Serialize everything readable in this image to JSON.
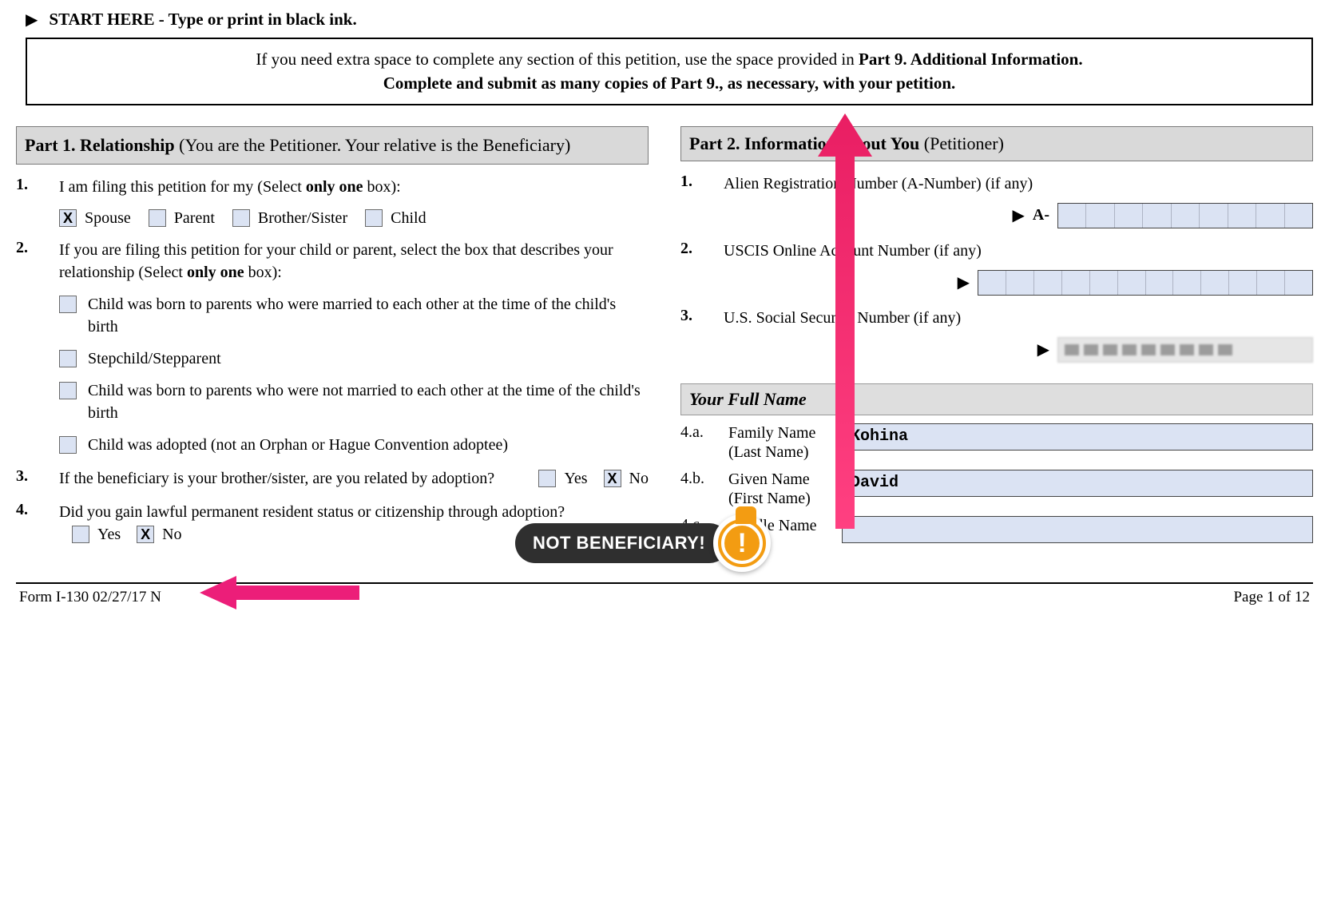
{
  "header": {
    "start_here": "START HERE - Type or print in black ink.",
    "notice_pre": "If you need extra space to complete any section of this petition, use the space provided in ",
    "notice_bold1": "Part 9. Additional Information.",
    "notice_line2a": "Complete and submit as many copies of Part 9., as necessary, with your petition."
  },
  "part1": {
    "title_bold": "Part 1.  Relationship",
    "title_rest": " (You are the Petitioner.  Your relative is the Beneficiary)",
    "q1": {
      "num": "1.",
      "text_pre": "I am filing this petition for my (Select ",
      "text_bold": "only one",
      "text_post": " box):",
      "spouse": "Spouse",
      "parent": "Parent",
      "brosis": "Brother/Sister",
      "child": "Child",
      "selected": "spouse"
    },
    "q2": {
      "num": "2.",
      "text_pre": "If you are filing this petition for your child or parent, select the box that describes your relationship (Select ",
      "text_bold": "only one",
      "text_post": " box):",
      "a": "Child was born to parents who were married to each other at the time of the child's birth",
      "b": "Stepchild/Stepparent",
      "c": "Child was born to parents who were not married to each other at the time of the child's birth",
      "d": "Child was adopted (not an Orphan or Hague Convention adoptee)"
    },
    "q3": {
      "num": "3.",
      "text": "If the beneficiary is your brother/sister, are you related by adoption?",
      "yes": "Yes",
      "no": "No",
      "answer": "no"
    },
    "q4": {
      "num": "4.",
      "text": "Did you gain lawful permanent resident status or citizenship through adoption?",
      "yes": "Yes",
      "no": "No",
      "answer": "no"
    }
  },
  "part2": {
    "title_bold": "Part 2.  Information About You",
    "title_rest": " (Petitioner)",
    "q1": {
      "num": "1.",
      "text": "Alien Registration Number (A-Number) (if any)",
      "prefix": "A-"
    },
    "q2": {
      "num": "2.",
      "text": "USCIS Online Account Number (if any)"
    },
    "q3": {
      "num": "3.",
      "text": "U.S. Social Security Number (if any)"
    },
    "name_section": "Your Full Name",
    "q4a": {
      "num": "4.a.",
      "label": "Family Name",
      "sub": "(Last Name)",
      "value": "Kohina"
    },
    "q4b": {
      "num": "4.b.",
      "label": "Given Name",
      "sub": "(First Name)",
      "value": "David"
    },
    "q4c": {
      "num": "4.c.",
      "label": "Middle Name",
      "value": ""
    }
  },
  "annotation": {
    "callout": "NOT BENEFICIARY!"
  },
  "footer": {
    "left": "Form I-130   02/27/17   N",
    "right": "Page 1 of 12"
  }
}
